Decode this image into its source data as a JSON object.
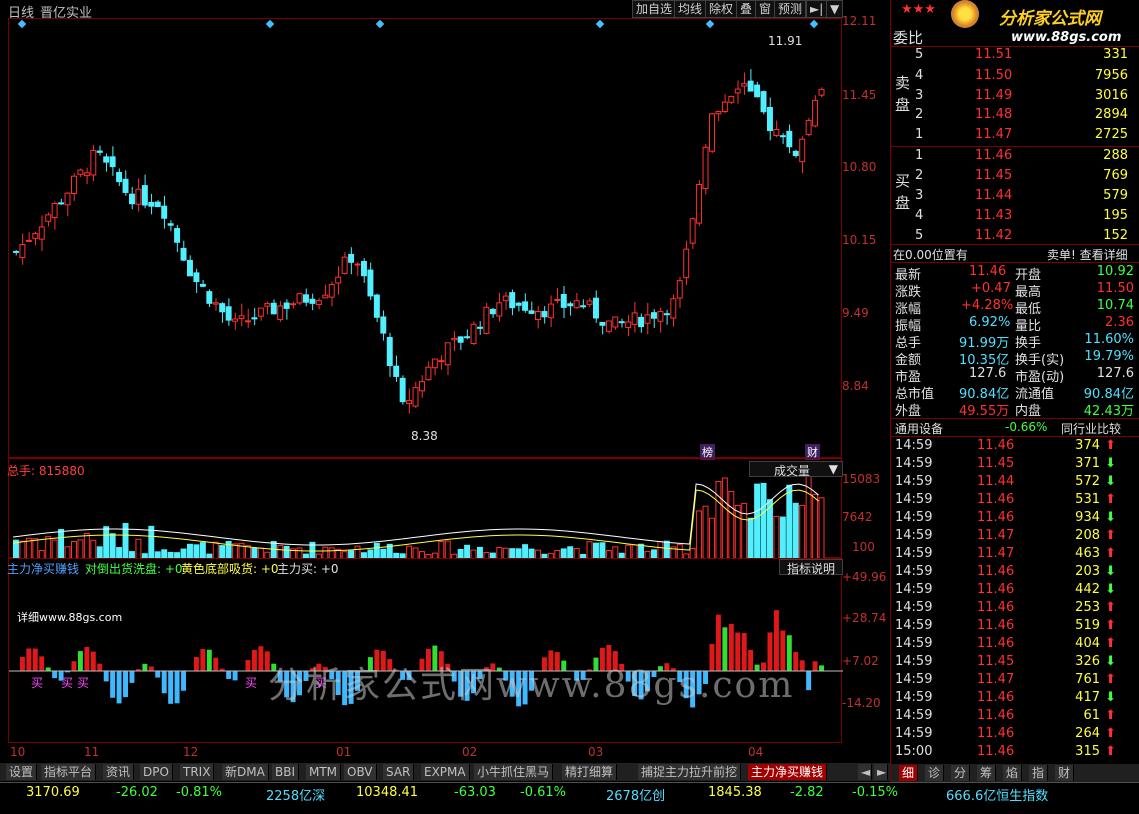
{
  "header": {
    "period": "日线",
    "stock_name": "晋亿实业",
    "buttons": [
      "加自选",
      "均线",
      "除权",
      "叠",
      "窗",
      "预测"
    ],
    "arrow_btn": "►|",
    "menu_btn": "▼"
  },
  "price_axis": [
    "12.11",
    "11.45",
    "10.80",
    "10.15",
    "9.49",
    "8.84"
  ],
  "annotations": {
    "high": "11.91",
    "low": "8.38",
    "badge1": "榜",
    "badge2": "财"
  },
  "volume": {
    "label": "总手: 815880",
    "dropdown": "成交量",
    "axis": [
      "15083",
      "7642",
      "100"
    ]
  },
  "indicator": {
    "title": "主力净买赚钱",
    "l1": "对倒出货洗盘: +0",
    "l2": "黄色底部吸货: +0",
    "l3": "主力买: +0",
    "help_btn": "指标说明",
    "detail": "详细www.88gs.com",
    "axis": [
      "+49.96",
      "+28.74",
      "+7.02",
      "-14.20"
    ],
    "buy_mark": "买"
  },
  "watermark": "分析家公式网www.88gs.com",
  "x_axis": [
    "10",
    "11",
    "12",
    "01",
    "02",
    "03",
    "04"
  ],
  "tabs": [
    "设置",
    "指标平台",
    "资讯",
    "DPO",
    "TRIX",
    "新DMA",
    "BBI",
    "MTM",
    "OBV",
    "SAR",
    "EXPMA",
    "小牛抓住黑马",
    "精打细算",
    "捕捉主力拉升前挖",
    "主力净买赚钱"
  ],
  "ticker": [
    {
      "v": "3170.69",
      "c": "yellow"
    },
    {
      "v": "-26.02",
      "c": "green"
    },
    {
      "v": "-0.81%",
      "c": "green"
    },
    {
      "v": "2258亿深",
      "c": "cyan"
    },
    {
      "v": "10348.41",
      "c": "yellow"
    },
    {
      "v": "-63.03",
      "c": "green"
    },
    {
      "v": "-0.61%",
      "c": "green"
    },
    {
      "v": "2678亿创",
      "c": "cyan"
    },
    {
      "v": "1845.38",
      "c": "yellow"
    },
    {
      "v": "-2.82",
      "c": "green"
    },
    {
      "v": "-0.15%",
      "c": "green"
    },
    {
      "v": "666.6亿恒生指数",
      "c": "cyan"
    }
  ],
  "logo": {
    "text": "分析家公式网",
    "url": "www.88gs.com",
    "stars": "★★★"
  },
  "orderbook": {
    "ratio_label": "委比",
    "sell_label": "卖盘",
    "buy_label": "买盘",
    "sells": [
      {
        "n": "5",
        "p": "11.51",
        "v": "331"
      },
      {
        "n": "4",
        "p": "11.50",
        "v": "7956"
      },
      {
        "n": "3",
        "p": "11.49",
        "v": "3016"
      },
      {
        "n": "2",
        "p": "11.48",
        "v": "2894"
      },
      {
        "n": "1",
        "p": "11.47",
        "v": "2725"
      }
    ],
    "buys": [
      {
        "n": "1",
        "p": "11.46",
        "v": "288"
      },
      {
        "n": "2",
        "p": "11.45",
        "v": "769"
      },
      {
        "n": "3",
        "p": "11.44",
        "v": "579"
      },
      {
        "n": "4",
        "p": "11.43",
        "v": "195"
      },
      {
        "n": "5",
        "p": "11.42",
        "v": "152"
      }
    ]
  },
  "status": {
    "left": "在0.00位置有",
    "right": "卖单! 查看详细"
  },
  "quote": [
    {
      "k1": "最新",
      "v1": "11.46",
      "c1": "red",
      "k2": "开盘",
      "v2": "10.92",
      "c2": "green"
    },
    {
      "k1": "涨跌",
      "v1": "+0.47",
      "c1": "red",
      "k2": "最高",
      "v2": "11.50",
      "c2": "red"
    },
    {
      "k1": "涨幅",
      "v1": "+4.28%",
      "c1": "red",
      "k2": "最低",
      "v2": "10.74",
      "c2": "green"
    },
    {
      "k1": "振幅",
      "v1": "6.92%",
      "c1": "cyan",
      "k2": "量比",
      "v2": "2.36",
      "c2": "red"
    },
    {
      "k1": "总手",
      "v1": "91.99万",
      "c1": "cyan",
      "k2": "换手",
      "v2": "11.60%",
      "c2": "cyan"
    },
    {
      "k1": "金额",
      "v1": "10.35亿",
      "c1": "cyan",
      "k2": "换手(实)",
      "v2": "19.79%",
      "c2": "cyan"
    },
    {
      "k1": "市盈",
      "v1": "127.6",
      "c1": "white",
      "k2": "市盈(动)",
      "v2": "127.6",
      "c2": "white"
    },
    {
      "k1": "总市值",
      "v1": "90.84亿",
      "c1": "cyan",
      "k2": "流通值",
      "v2": "90.84亿",
      "c2": "cyan"
    },
    {
      "k1": "外盘",
      "v1": "49.55万",
      "c1": "red",
      "k2": "内盘",
      "v2": "42.43万",
      "c2": "green"
    }
  ],
  "sector": {
    "name": "通用设备",
    "chg": "-0.66%",
    "btn": "同行业比较"
  },
  "ticks": [
    {
      "t": "14:59",
      "p": "11.46",
      "v": "374",
      "d": "up"
    },
    {
      "t": "14:59",
      "p": "11.45",
      "v": "371",
      "d": "down"
    },
    {
      "t": "14:59",
      "p": "11.44",
      "v": "572",
      "d": "down"
    },
    {
      "t": "14:59",
      "p": "11.46",
      "v": "531",
      "d": "up"
    },
    {
      "t": "14:59",
      "p": "11.46",
      "v": "934",
      "d": "down"
    },
    {
      "t": "14:59",
      "p": "11.47",
      "v": "208",
      "d": "up"
    },
    {
      "t": "14:59",
      "p": "11.47",
      "v": "463",
      "d": "up"
    },
    {
      "t": "14:59",
      "p": "11.46",
      "v": "203",
      "d": "down"
    },
    {
      "t": "14:59",
      "p": "11.46",
      "v": "442",
      "d": "down"
    },
    {
      "t": "14:59",
      "p": "11.46",
      "v": "253",
      "d": "up"
    },
    {
      "t": "14:59",
      "p": "11.46",
      "v": "519",
      "d": "up"
    },
    {
      "t": "14:59",
      "p": "11.46",
      "v": "404",
      "d": "up"
    },
    {
      "t": "14:59",
      "p": "11.45",
      "v": "326",
      "d": "down"
    },
    {
      "t": "14:59",
      "p": "11.47",
      "v": "761",
      "d": "up"
    },
    {
      "t": "14:59",
      "p": "11.46",
      "v": "417",
      "d": "down"
    },
    {
      "t": "14:59",
      "p": "11.46",
      "v": "61",
      "d": "up"
    },
    {
      "t": "14:59",
      "p": "11.46",
      "v": "264",
      "d": "up"
    },
    {
      "t": "15:00",
      "p": "11.46",
      "v": "315",
      "d": "up"
    }
  ],
  "bottom_tabs": [
    "细",
    "诊",
    "分",
    "筹",
    "焰",
    "指",
    "财"
  ]
}
